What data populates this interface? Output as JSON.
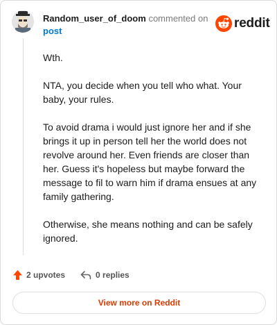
{
  "header": {
    "username": "Random_user_of_doom",
    "action": "commented on",
    "post_link": "post",
    "logo_word": "reddit",
    "avatar_icon": "avatar-icon",
    "logo_icon": "reddit-snoo-icon"
  },
  "comment": {
    "paragraphs": [
      "Wth.",
      "NTA, you decide when you tell who what. Your baby, your rules.",
      "To avoid drama i would just ignore her and if she brings it up in person tell her the world does not revolve around her. Even friends are closer than her. Guess it's hopeless but maybe forward the message to fil to warn him if drama ensues at any family gathering.",
      "Otherwise, she means nothing and can be safely ignored."
    ]
  },
  "footer": {
    "upvotes": "2 upvotes",
    "replies": "0 replies",
    "upvote_icon": "upvote-arrow-icon",
    "reply_icon": "reply-arrow-icon"
  },
  "view_more": {
    "label": "View more on Reddit"
  },
  "colors": {
    "brand": "#ff4500",
    "link": "#0079d3",
    "view_more_text": "#d93a00"
  }
}
